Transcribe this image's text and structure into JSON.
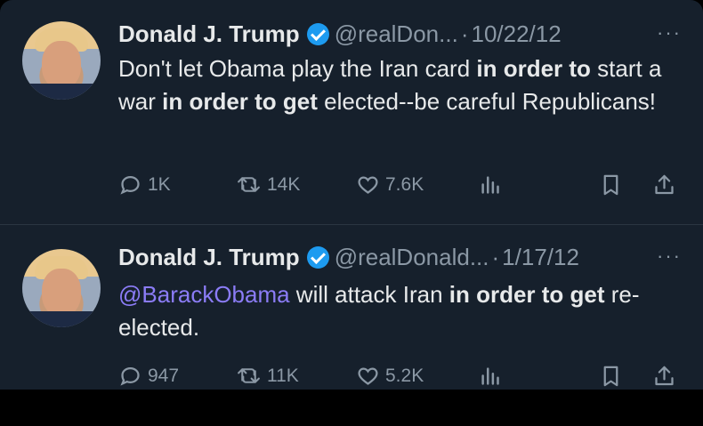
{
  "tweets": [
    {
      "name": "Donald J. Trump",
      "handle": "@realDon...",
      "date": "10/22/12",
      "text_parts": [
        {
          "text": "Don't let Obama play the Iran card ",
          "style": "normal"
        },
        {
          "text": "in order to",
          "style": "bold"
        },
        {
          "text": " start a war ",
          "style": "normal"
        },
        {
          "text": "in order to get",
          "style": "bold"
        },
        {
          "text": " elected--be careful Republicans!",
          "style": "normal"
        }
      ],
      "replies": "1K",
      "retweets": "14K",
      "likes": "7.6K"
    },
    {
      "name": "Donald J. Trump",
      "handle": "@realDonald...",
      "date": "1/17/12",
      "text_parts": [
        {
          "text": "@BarackObama",
          "style": "mention"
        },
        {
          "text": " will attack Iran ",
          "style": "normal"
        },
        {
          "text": "in order to get",
          "style": "bold"
        },
        {
          "text": " re-elected.",
          "style": "normal"
        }
      ],
      "replies": "947",
      "retweets": "11K",
      "likes": "5.2K"
    }
  ],
  "ui": {
    "separator": "·",
    "more_label": "···"
  },
  "icons": [
    "reply-icon",
    "retweet-icon",
    "like-icon",
    "views-icon",
    "bookmark-icon",
    "share-icon"
  ],
  "colors": {
    "background": "#16202c",
    "text": "#e7e9ea",
    "muted": "#8b98a5",
    "verified": "#1d9bf0",
    "mention": "#8b7cf6"
  }
}
